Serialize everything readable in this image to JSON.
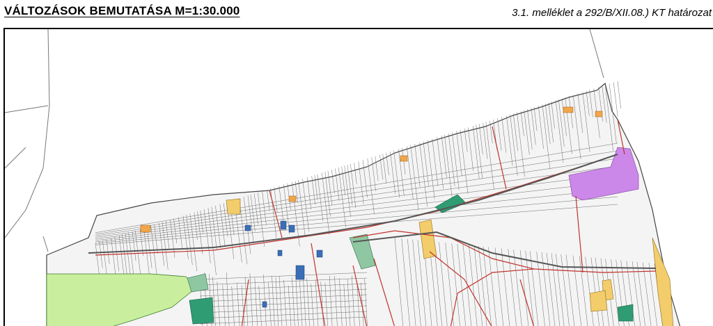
{
  "header": {
    "title": "VÁLTOZÁSOK BEMUTATÁSA   M=1:30.000",
    "annex": "3.1. melléklet a 292/B/XII.08.) KT határozat"
  },
  "map": {
    "colors": {
      "background": "#ffffff",
      "parcel_lines": "#555555",
      "road_red": "#c0312b",
      "agricultural_green": "#c9ef9e",
      "forest_green": "#2f9c74",
      "park_green": "#8fc7a2",
      "yellow_zone": "#f3cc6b",
      "orange_zone": "#f2a64a",
      "blue_zone": "#3a6fb6",
      "purple_zone": "#cc88e8"
    }
  }
}
